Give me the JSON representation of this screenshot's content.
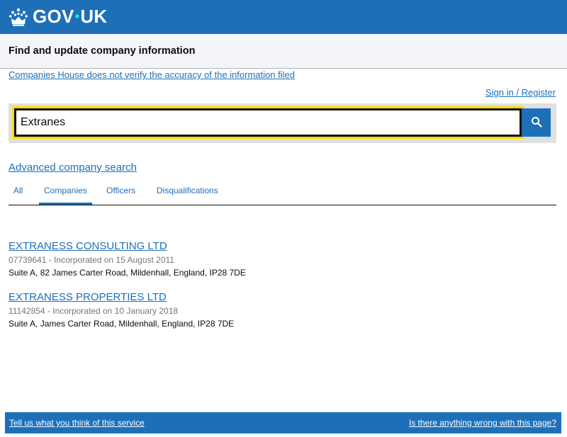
{
  "header": {
    "logo_text_left": "GOV",
    "logo_dot": "•",
    "logo_text_right": "UK",
    "crown_icon": "crown-icon"
  },
  "service": {
    "name": "Find and update company information"
  },
  "disclaimer": "Companies House does not verify the accuracy of the information filed",
  "account": {
    "sign_in_label": "Sign in / Register"
  },
  "search": {
    "value": "Extranes",
    "button_icon": "search-icon"
  },
  "advanced_search_label": "Advanced company search",
  "tabs": [
    {
      "label": "All",
      "active": false
    },
    {
      "label": "Companies",
      "active": true
    },
    {
      "label": "Officers",
      "active": false
    },
    {
      "label": "Disqualifications",
      "active": false
    }
  ],
  "results": [
    {
      "name": "EXTRANESS CONSULTING LTD",
      "meta": "07739641 - Incorporated on 15 August 2011",
      "address": "Suite A, 82 James Carter Road, Mildenhall, England, IP28 7DE"
    },
    {
      "name": "EXTRANESS PROPERTIES LTD",
      "meta": "11142854 - Incorporated on 10 January 2018",
      "address": "Suite A, James Carter Road, Mildenhall, England, IP28 7DE"
    }
  ],
  "footer": {
    "feedback_label": "Tell us what you think of this service",
    "report_label": "Is there anything wrong with this page?"
  },
  "colors": {
    "brand_blue": "#1d70b8",
    "focus_yellow": "#ffdd00",
    "text": "#0b0c0c",
    "secondary_text": "#6f777b"
  }
}
